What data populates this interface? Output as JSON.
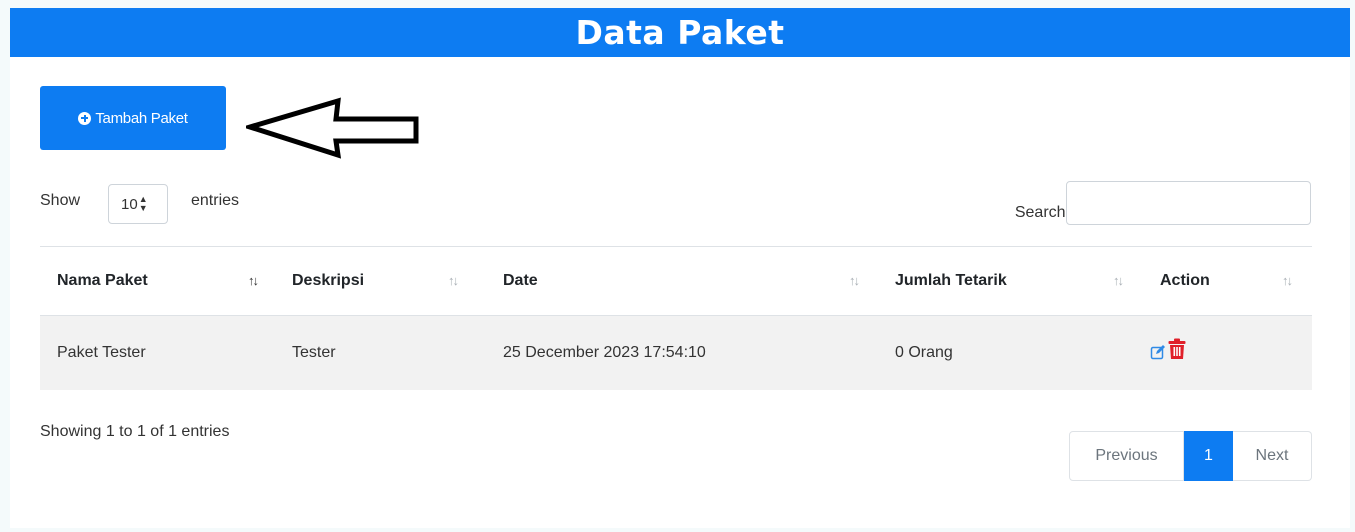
{
  "header": {
    "title": "Data Paket"
  },
  "toolbar": {
    "add_label": "Tambah Paket"
  },
  "length": {
    "show_label": "Show",
    "value": "10",
    "entries_label": "entries"
  },
  "search": {
    "label": "Search:",
    "value": ""
  },
  "table": {
    "columns": [
      "Nama Paket",
      "Deskripsi",
      "Date",
      "Jumlah Tetarik",
      "Action"
    ],
    "rows": [
      {
        "nama": "Paket Tester",
        "deskripsi": "Tester",
        "date": "25 December 2023 17:54:10",
        "jumlah": "0 Orang"
      }
    ]
  },
  "footer": {
    "info": "Showing 1 to 1 of 1 entries",
    "prev_label": "Previous",
    "page": "1",
    "next_label": "Next"
  },
  "colors": {
    "primary": "#0d7cf2",
    "danger": "#e0202a",
    "row_bg": "#f2f2f2"
  },
  "icons": [
    "plus-circle-icon",
    "left-arrow-annotation",
    "sort-icon",
    "edit-icon",
    "trash-icon"
  ]
}
